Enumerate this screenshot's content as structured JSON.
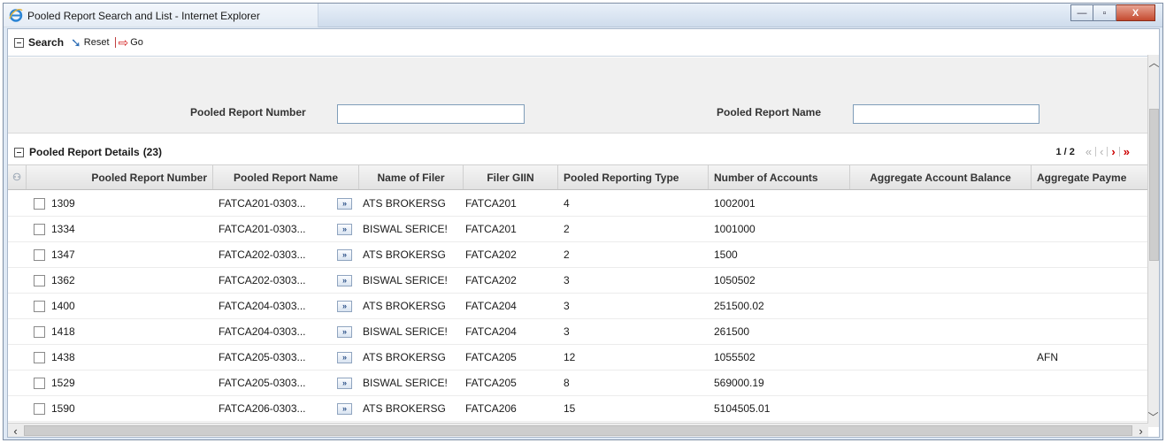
{
  "window": {
    "title": "Pooled Report Search and List - Internet Explorer",
    "controls": {
      "minimize": "—",
      "maximize": "▫",
      "close": "X"
    }
  },
  "toolbar": {
    "search_label": "Search",
    "reset_label": "Reset",
    "go_label": "Go",
    "icons": {
      "collapse": "collapse-box-icon",
      "reset": "reset-arrow-icon",
      "go": "go-arrow-icon"
    }
  },
  "search": {
    "number_label": "Pooled Report Number",
    "number_value": "",
    "name_label": "Pooled Report Name",
    "name_value": ""
  },
  "details": {
    "title": "Pooled Report Details",
    "count": "(23)",
    "pager": {
      "page": "1 / 2",
      "first": "«",
      "prev": "‹",
      "next": "›",
      "last": "»"
    }
  },
  "grid": {
    "columns": [
      "Pooled Report Number",
      "Pooled Report Name",
      "Name of Filer",
      "Filer GIIN",
      "Pooled Reporting Type",
      "Number of Accounts",
      "Aggregate Account Balance",
      "Aggregate Payme"
    ],
    "rows": [
      {
        "number": "1309",
        "name": "FATCA201-0303...",
        "filer": "ATS BROKERSG",
        "giin": "FATCA201",
        "type": "4",
        "accounts": "1002001",
        "balance": "",
        "payment": ""
      },
      {
        "number": "1334",
        "name": "FATCA201-0303...",
        "filer": "BISWAL SERICE!",
        "giin": "FATCA201",
        "type": "2",
        "accounts": "1001000",
        "balance": "",
        "payment": ""
      },
      {
        "number": "1347",
        "name": "FATCA202-0303...",
        "filer": "ATS BROKERSG",
        "giin": "FATCA202",
        "type": "2",
        "accounts": "1500",
        "balance": "",
        "payment": ""
      },
      {
        "number": "1362",
        "name": "FATCA202-0303...",
        "filer": "BISWAL SERICE!",
        "giin": "FATCA202",
        "type": "3",
        "accounts": "1050502",
        "balance": "",
        "payment": ""
      },
      {
        "number": "1400",
        "name": "FATCA204-0303...",
        "filer": "ATS BROKERSG",
        "giin": "FATCA204",
        "type": "3",
        "accounts": "251500.02",
        "balance": "",
        "payment": ""
      },
      {
        "number": "1418",
        "name": "FATCA204-0303...",
        "filer": "BISWAL SERICE!",
        "giin": "FATCA204",
        "type": "3",
        "accounts": "261500",
        "balance": "",
        "payment": ""
      },
      {
        "number": "1438",
        "name": "FATCA205-0303...",
        "filer": "ATS BROKERSG",
        "giin": "FATCA205",
        "type": "12",
        "accounts": "1055502",
        "balance": "",
        "payment": "AFN"
      },
      {
        "number": "1529",
        "name": "FATCA205-0303...",
        "filer": "BISWAL SERICE!",
        "giin": "FATCA205",
        "type": "8",
        "accounts": "569000.19",
        "balance": "",
        "payment": ""
      },
      {
        "number": "1590",
        "name": "FATCA206-0303...",
        "filer": "ATS BROKERSG",
        "giin": "FATCA206",
        "type": "15",
        "accounts": "5104505.01",
        "balance": "",
        "payment": ""
      }
    ]
  },
  "colors": {
    "accent": "#cc0000",
    "reset_blue": "#2e6eb5",
    "panel": "#f0f0f0",
    "header": "#e2e2e2"
  }
}
